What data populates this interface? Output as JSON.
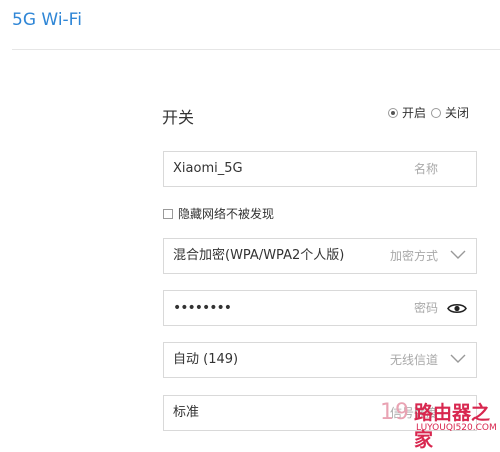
{
  "header": {
    "title": "5G Wi-Fi"
  },
  "switch": {
    "label": "开关",
    "options": [
      {
        "label": "开启",
        "selected": true
      },
      {
        "label": "关闭",
        "selected": false
      }
    ]
  },
  "ssid_field": {
    "value": "Xiaomi_5G",
    "hint": "名称"
  },
  "hide_network": {
    "label": "隐藏网络不被发现",
    "checked": false
  },
  "encryption_field": {
    "value": "混合加密(WPA/WPA2个人版)",
    "hint": "加密方式",
    "icon": "chevron-down-icon"
  },
  "password_field": {
    "value": "••••••••",
    "hint": "密码",
    "icon": "eye-icon"
  },
  "channel_field": {
    "value": "自动 (149)",
    "hint": "无线信道",
    "icon": "chevron-down-icon"
  },
  "signal_field": {
    "value": "标准",
    "hint": "信号强度"
  },
  "watermark": {
    "number": "19",
    "text": "路由器之家",
    "url": "LUYOUQI520.COM"
  },
  "colors": {
    "accent": "#2f86d6",
    "border": "#d9d9d9",
    "hint": "#a8a8a8",
    "watermark": "#d8274f"
  }
}
